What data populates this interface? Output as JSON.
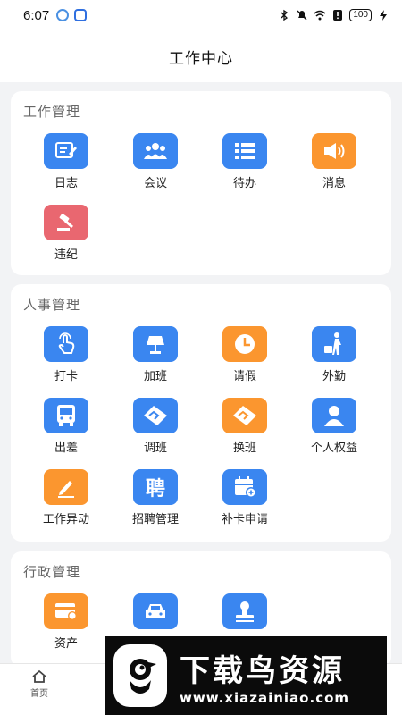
{
  "status_bar": {
    "time": "6:07",
    "battery": "100"
  },
  "header": {
    "title": "工作中心"
  },
  "sections": {
    "work": {
      "title": "工作管理",
      "items": [
        {
          "label": "日志",
          "icon": "journal-icon",
          "color": "#3a86f0"
        },
        {
          "label": "会议",
          "icon": "meeting-icon",
          "color": "#3a86f0"
        },
        {
          "label": "待办",
          "icon": "todo-list-icon",
          "color": "#3a86f0"
        },
        {
          "label": "消息",
          "icon": "megaphone-icon",
          "color": "#fb962f"
        },
        {
          "label": "违纪",
          "icon": "gavel-icon",
          "color": "#e96770"
        }
      ]
    },
    "hr": {
      "title": "人事管理",
      "items": [
        {
          "label": "打卡",
          "icon": "tap-icon",
          "color": "#3a86f0"
        },
        {
          "label": "加班",
          "icon": "lamp-icon",
          "color": "#3a86f0"
        },
        {
          "label": "请假",
          "icon": "clock-icon",
          "color": "#fb962f"
        },
        {
          "label": "外勤",
          "icon": "traveler-icon",
          "color": "#3a86f0"
        },
        {
          "label": "出差",
          "icon": "bus-icon",
          "color": "#3a86f0"
        },
        {
          "label": "调班",
          "icon": "handshake-icon",
          "color": "#3a86f0"
        },
        {
          "label": "换班",
          "icon": "handshake-icon",
          "color": "#fb962f"
        },
        {
          "label": "个人权益",
          "icon": "person-icon",
          "color": "#3a86f0"
        },
        {
          "label": "工作异动",
          "icon": "pen-icon",
          "color": "#fb962f"
        },
        {
          "label": "招聘管理",
          "icon": "recruit-icon",
          "icon_text": "聘",
          "color": "#3a86f0"
        },
        {
          "label": "补卡申请",
          "icon": "calendar-add-icon",
          "color": "#3a86f0"
        }
      ]
    },
    "admin": {
      "title": "行政管理",
      "items": [
        {
          "label": "资产",
          "icon": "asset-card-icon",
          "color": "#fb962f"
        },
        {
          "label": "",
          "icon": "car-icon",
          "color": "#3a86f0"
        },
        {
          "label": "",
          "icon": "stamp-icon",
          "color": "#3a86f0"
        }
      ]
    }
  },
  "bottom_nav": {
    "home_label": "首页"
  },
  "watermark": {
    "title": "下载鸟资源",
    "url": "www.xiazainiao.com"
  }
}
